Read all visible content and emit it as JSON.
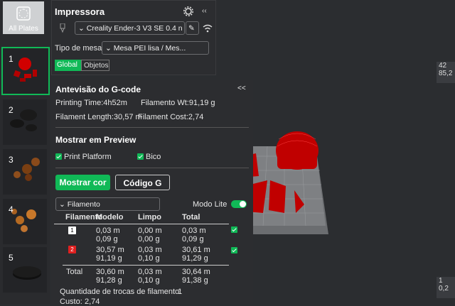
{
  "plates": {
    "all_label": "All Plates",
    "items": [
      "1",
      "2",
      "3",
      "4",
      "5"
    ]
  },
  "printer": {
    "title": "Impressora",
    "preset": "Creality Ender-3 V3 SE 0.4 n",
    "bed_label": "Tipo de mesa",
    "bed_value": "Mesa PEI lisa / Mes...",
    "tab_global": "Global",
    "tab_objects": "Objetos"
  },
  "preview": {
    "title": "Antevisão do G-code",
    "collapse": "<<",
    "printing_time": "Printing Time:4h52m",
    "filament_wt": "Filamento Wt:91,19 g",
    "filament_length": "Filament Length:30,57 m",
    "filament_cost": "Filament Cost:2,74",
    "show_title": "Mostrar em Preview",
    "opt_platform": "Print Platform",
    "opt_nozzle": "Bico",
    "btn_color": "Mostrar cor",
    "btn_gcode": "Código G",
    "view_select": "Filamento",
    "lite_label": "Modo Lite",
    "table": {
      "headers": [
        "Filamento",
        "Modelo",
        "Limpo",
        "Total"
      ],
      "rows": [
        {
          "id": "1",
          "color": "#ffffff",
          "modelo": [
            "0,03 m",
            "0,09 g"
          ],
          "limpo": [
            "0,00 m",
            "0,00 g"
          ],
          "total": [
            "0,03 m",
            "0,09 g"
          ]
        },
        {
          "id": "2",
          "color": "#e02020",
          "modelo": [
            "30,57 m",
            "91,19 g"
          ],
          "limpo": [
            "0,03 m",
            "0,10 g"
          ],
          "total": [
            "30,61 m",
            "91,29 g"
          ]
        }
      ],
      "total_row": {
        "label": "Total",
        "modelo": [
          "30,60 m",
          "91,28 g"
        ],
        "limpo": [
          "0,03 m",
          "0,10 g"
        ],
        "total": [
          "30,64 m",
          "91,38 g"
        ]
      }
    },
    "changes_label": "Quantidade de trocas de filamento:",
    "changes_value": "1",
    "cost_label": "Custo:",
    "cost_value": "2,74"
  },
  "viewport": {
    "edge_top": [
      "42",
      "85,2"
    ],
    "edge_bottom": [
      "1",
      "0,2"
    ]
  },
  "colors": {
    "accent": "#10b957",
    "model": "#cc0000",
    "panel": "#2c2d30"
  }
}
